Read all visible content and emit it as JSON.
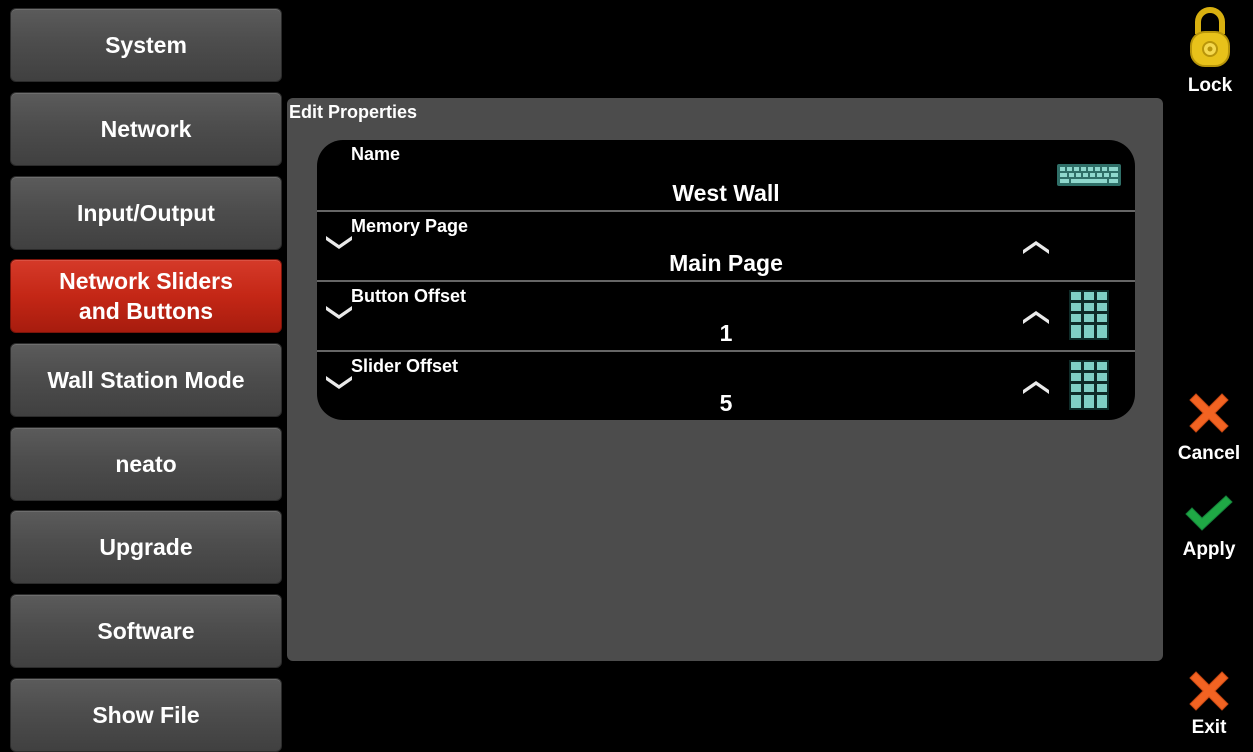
{
  "sidebar": {
    "items": [
      {
        "label": "System"
      },
      {
        "label": "Network"
      },
      {
        "label": "Input/Output"
      },
      {
        "label": "Network Sliders\nand Buttons",
        "active": true
      },
      {
        "label": "Wall Station Mode"
      },
      {
        "label": "neato"
      },
      {
        "label": "Upgrade"
      },
      {
        "label": "Software"
      },
      {
        "label": "Show File"
      }
    ]
  },
  "panel": {
    "title": "Edit Properties",
    "properties": [
      {
        "label": "Name",
        "value": "West Wall",
        "control": "keyboard-icon"
      },
      {
        "label": "Memory Page",
        "value": "Main Page",
        "control": "stepper"
      },
      {
        "label": "Button Offset",
        "value": "1",
        "control": "keypad-icon"
      },
      {
        "label": "Slider Offset",
        "value": "5",
        "control": "keypad-icon"
      }
    ]
  },
  "tools": {
    "lock": "Lock",
    "cancel": "Cancel",
    "apply": "Apply",
    "exit": "Exit"
  },
  "colors": {
    "active_nav": "#c42716",
    "panel_bg": "#4c4c4c",
    "lock_gold": "#e8c21a",
    "cancel_orange": "#f26322",
    "apply_green": "#1fa845",
    "keypad_teal": "#7fcfc4"
  }
}
